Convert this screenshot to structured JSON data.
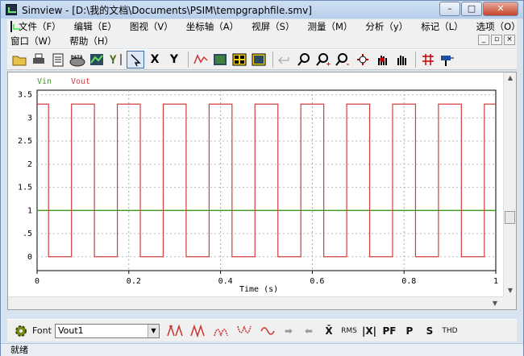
{
  "window": {
    "title": "Simview - [D:\\我的文档\\Documents\\PSIM\\tempgraphfile.smv]",
    "minimize_label": "–",
    "maximize_label": "□",
    "close_label": "✕"
  },
  "menu": {
    "row1": [
      "文件（F）",
      "编辑（E）",
      "图视（V）",
      "坐标轴（A）",
      "视屏（S）",
      "测量（M）",
      "分析（y）",
      "标记（L）",
      "选项（O）"
    ],
    "row2": [
      "窗口（W）",
      "帮助（H）"
    ]
  },
  "toolbar": {
    "icons": [
      "open-icon",
      "print-icon",
      "clipboard-icon",
      "data-icon",
      "graph-icon",
      "y-axis-icon",
      "pointer-icon",
      "x-axis-button",
      "y-axis-button",
      "waveform-icon",
      "screen-icon",
      "grid-icon",
      "screen2-icon",
      "undo-icon",
      "zoom-icon",
      "zoom-in-icon",
      "zoom-out-icon",
      "pan-icon",
      "hand-icon",
      "hand2-icon",
      "crosshair-icon",
      "marker-icon"
    ],
    "x_label": "X",
    "y_label": "Y"
  },
  "bottom": {
    "font_label": "Font",
    "series_selected": "Vout1",
    "x_abs_label": "X̄",
    "rms_label": "RMS",
    "abs_label": "|X|",
    "pf_label": "PF",
    "p_label": "P",
    "s_label": "S",
    "thd_label": "THD"
  },
  "status": {
    "text": "就绪"
  },
  "chart_data": {
    "type": "line",
    "xlabel": "Time (s)",
    "ylabel": "",
    "xlim": [
      0,
      1
    ],
    "ylim": [
      -0.3,
      3.6
    ],
    "xticks": [
      0,
      0.2,
      0.4,
      0.6,
      0.8,
      1
    ],
    "xtick_labels": [
      "0",
      "0.2",
      "0.4",
      "0.6",
      "0.8",
      "1"
    ],
    "yticks": [
      0,
      0.5,
      1,
      1.5,
      2,
      2.5,
      3,
      3.5
    ],
    "ytick_labels": [
      "0",
      ".5",
      "1",
      "1.5",
      "2",
      "2.5",
      "3",
      "3.5"
    ],
    "grid": true,
    "legend_position": "top-left",
    "series": [
      {
        "name": "Vin",
        "color": "#3a9a1a",
        "x": [
          0,
          1
        ],
        "y": [
          1,
          1
        ]
      },
      {
        "name": "Vout",
        "color": "#d04040",
        "x": [
          0,
          0.0,
          0.025,
          0.025,
          0.075,
          0.075,
          0.125,
          0.125,
          0.175,
          0.175,
          0.225,
          0.225,
          0.275,
          0.275,
          0.325,
          0.325,
          0.375,
          0.375,
          0.425,
          0.425,
          0.475,
          0.475,
          0.525,
          0.525,
          0.575,
          0.575,
          0.625,
          0.625,
          0.675,
          0.675,
          0.725,
          0.725,
          0.775,
          0.775,
          0.825,
          0.825,
          0.875,
          0.875,
          0.925,
          0.925,
          0.975,
          0.975,
          1
        ],
        "y": [
          3.3,
          3.3,
          3.3,
          0,
          0,
          3.3,
          3.3,
          0,
          0,
          3.3,
          3.3,
          0,
          0,
          3.3,
          3.3,
          0,
          0,
          3.3,
          3.3,
          0,
          0,
          3.3,
          3.3,
          0,
          0,
          3.3,
          3.3,
          0,
          0,
          3.3,
          3.3,
          0,
          0,
          3.3,
          3.3,
          0,
          0,
          3.3,
          3.3,
          0,
          0,
          3.3,
          3.3
        ]
      }
    ]
  }
}
